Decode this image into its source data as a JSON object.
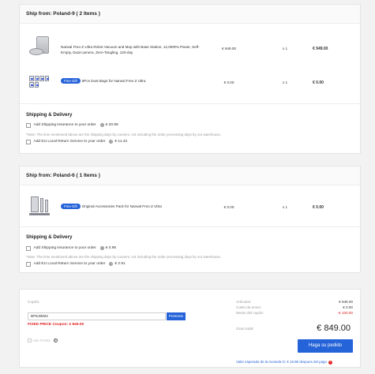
{
  "shipments": [
    {
      "header": "Ship from: Poland-9 ( 2 Items )",
      "items": [
        {
          "name": "Narwal Freo Z Ultra Robot Vacuum and Mop with Base Station, 12,000Pa Power, Self-Empty, Dual-camera, Zero-Tangling, 120-day",
          "price": "€ 949.00",
          "qty": "x 1",
          "total": "€ 949.00",
          "gift": ""
        },
        {
          "name": "6Pcs Dust Bags for Narwal Freo Z Ultra",
          "price": "€ 0.00",
          "qty": "x 1",
          "total": "€ 0.00",
          "gift": "Free Gift"
        }
      ],
      "shipping_title": "Shipping & Delivery",
      "insurance_label": "Add Shipping insurance to your order",
      "insurance_price": "€ 20.89",
      "note": "*Note: The time mentioned above are the shipping days by couriers, not including the order processing days by our warehouse.",
      "return_label": "Add EU Local Return Service to your order",
      "return_price": "€ 11.43"
    },
    {
      "header": "Ship from: Poland-6 ( 1 Items )",
      "items": [
        {
          "name": "Original Accessories Pack for Narwal Freo Z Ultra",
          "price": "€ 0.00",
          "qty": "x 1",
          "total": "€ 0.00",
          "gift": "Free Gift"
        }
      ],
      "shipping_title": "Shipping & Delivery",
      "insurance_label": "Add Shipping insurance to your order",
      "insurance_price": "€ 0.95",
      "note": "*Note: The time mentioned above are the shipping days by couriers, not including the order processing days by our warehouse.",
      "return_label": "Add EU Local Return Service to your order",
      "return_price": "€ 2.91"
    }
  ],
  "summary": {
    "coupon_label": "Cupón:",
    "coupon_value": "BFEZBM1",
    "apply_label": "Presente",
    "coupon_applied": "FIXED PRICE Coupon: € 849.00",
    "points_label": "Use Points",
    "articles_label": "Artículos:",
    "articles_value": "€ 949.00",
    "shipping_label": "Costo de envío:",
    "shipping_value": "€ 0.00",
    "coupon_amount_label": "Monto del cupón:",
    "coupon_amount_value": "-€ 100.00",
    "grand_label": "Gran total:",
    "grand_value": "€ 849.00",
    "order_button": "Haga su pedido",
    "expected_value": "Valor esperado de la moneda G: € 16.98 despues del pago"
  },
  "colors": {
    "accent": "#2563d9",
    "discount": "#e02020"
  }
}
